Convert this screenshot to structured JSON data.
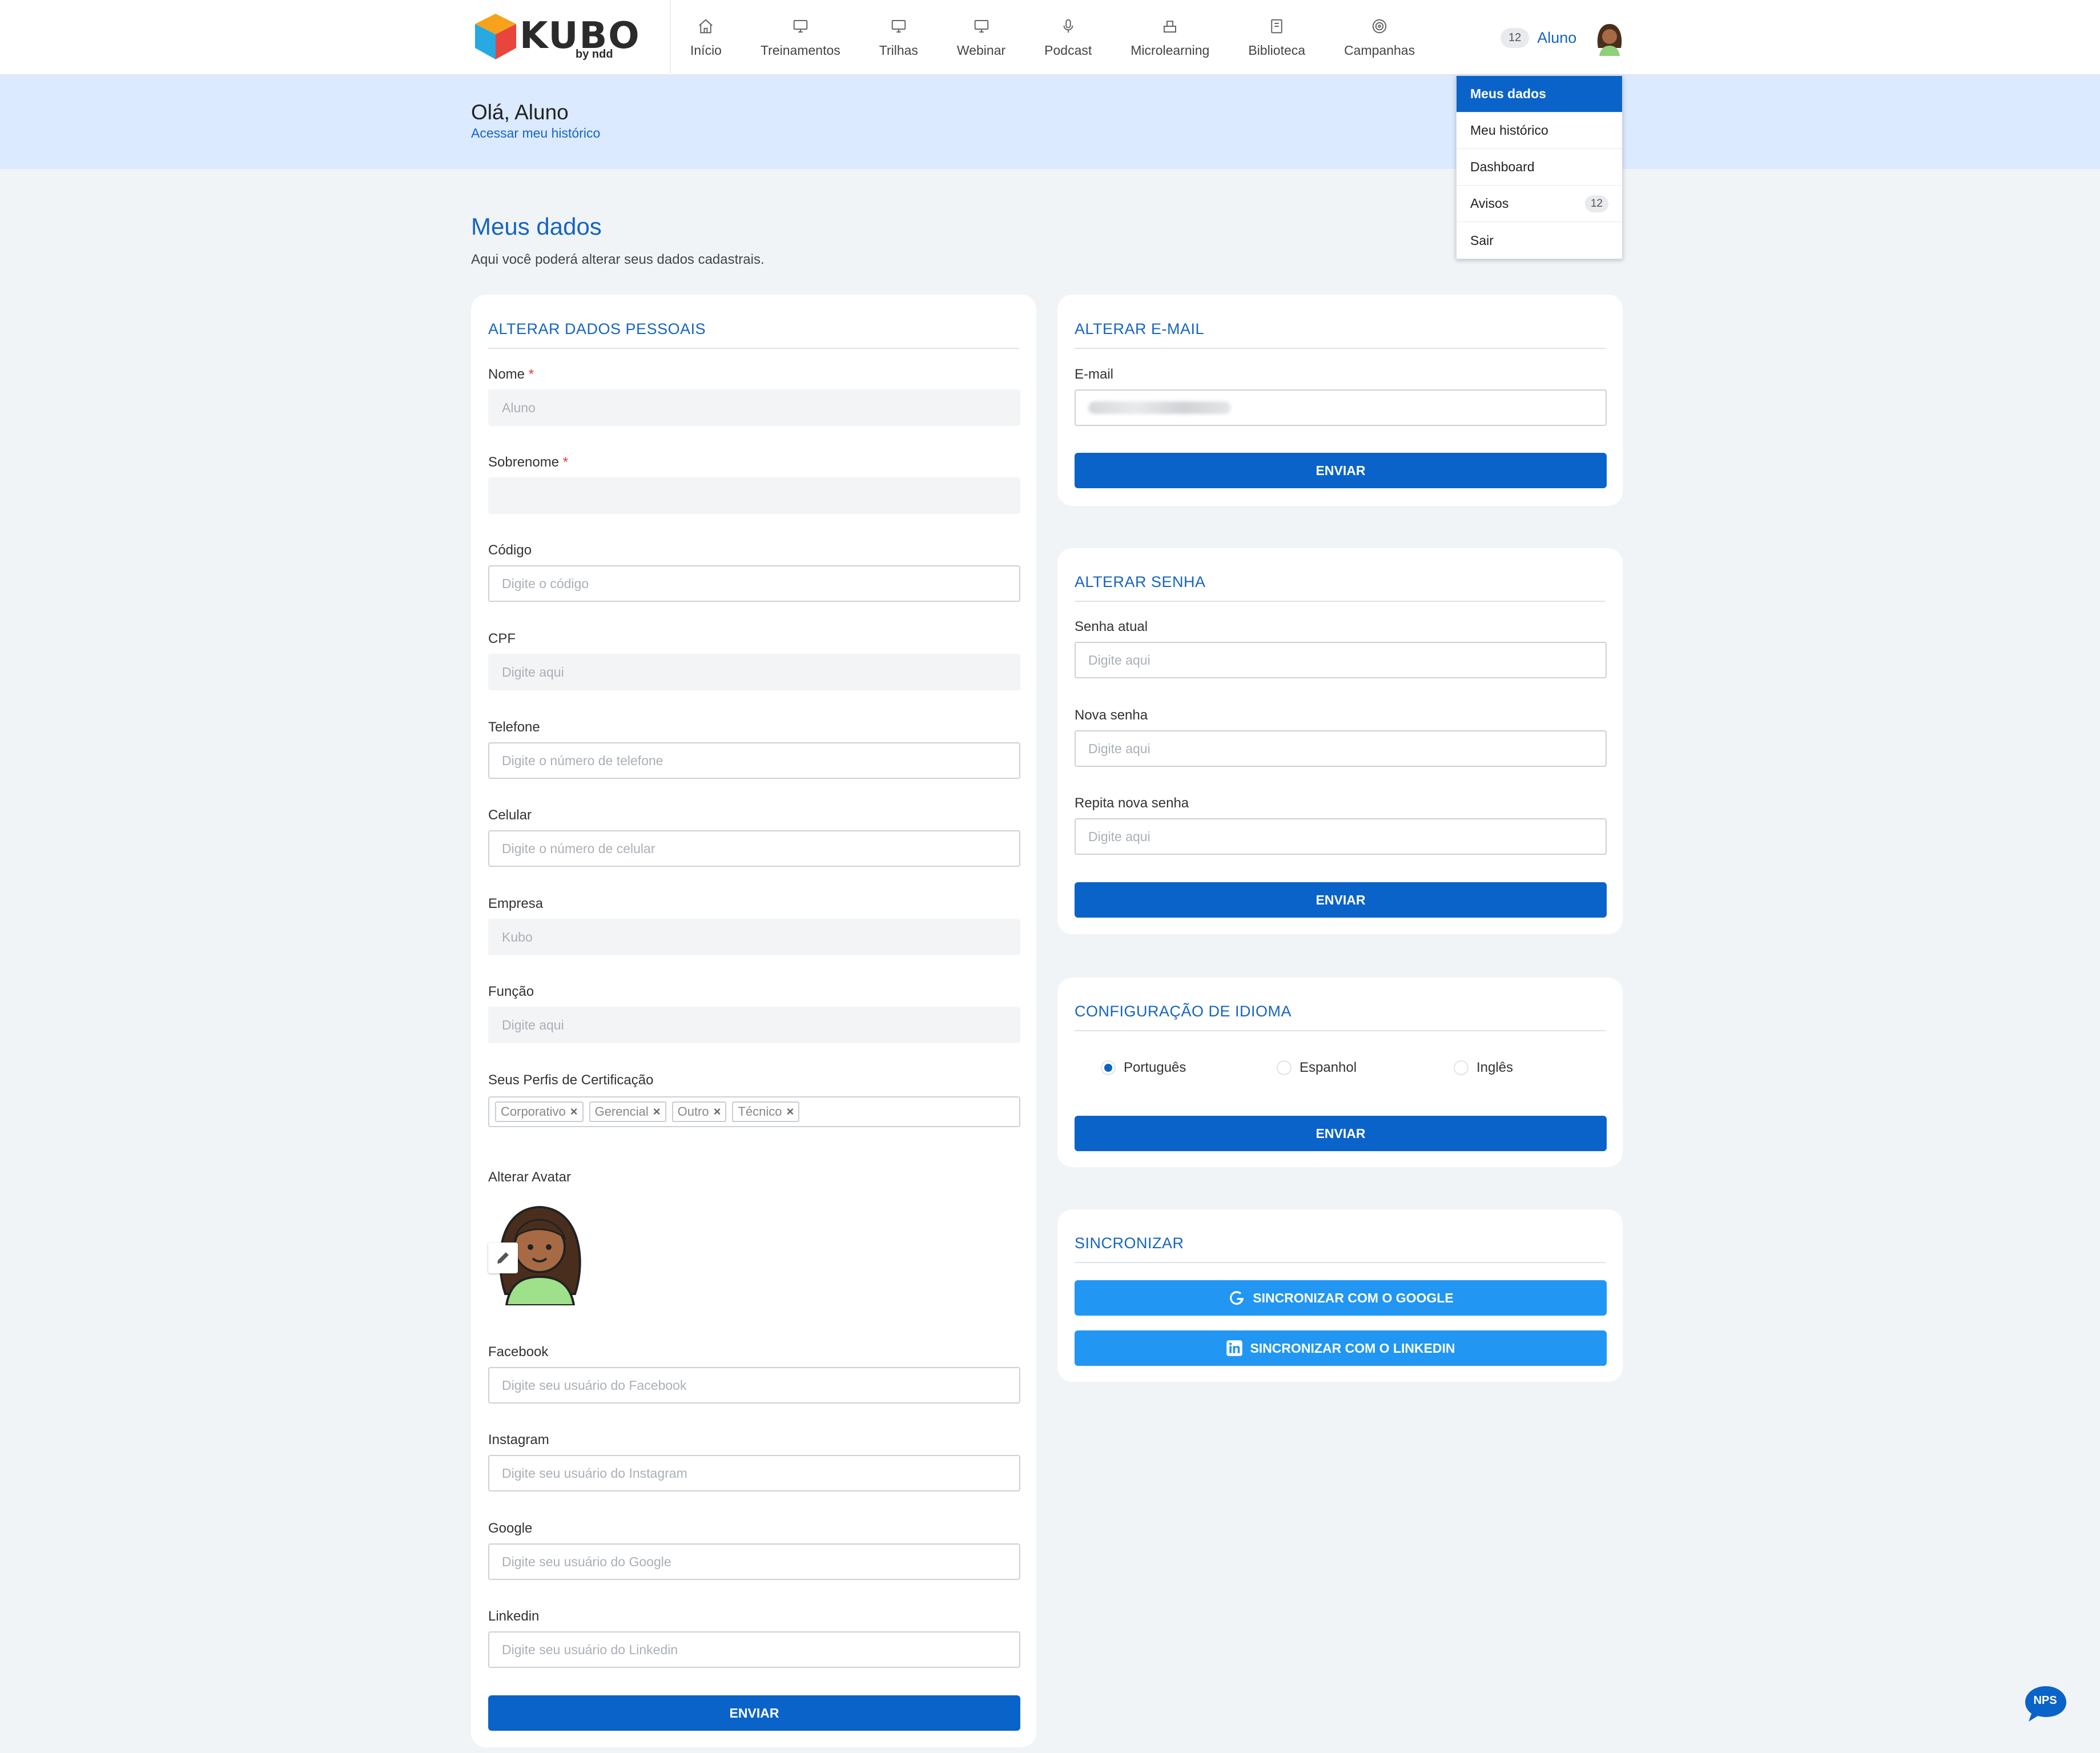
{
  "brand": {
    "logo_text": "KUBO",
    "logo_sub": "by ndd",
    "accent": "#0a63c9"
  },
  "nav": [
    {
      "label": "Início",
      "icon": "home-icon"
    },
    {
      "label": "Treinamentos",
      "icon": "monitor-icon"
    },
    {
      "label": "Trilhas",
      "icon": "monitor-icon"
    },
    {
      "label": "Webinar",
      "icon": "monitor-icon"
    },
    {
      "label": "Podcast",
      "icon": "microphone-icon"
    },
    {
      "label": "Microlearning",
      "icon": "blocks-icon"
    },
    {
      "label": "Biblioteca",
      "icon": "book-icon"
    },
    {
      "label": "Campanhas",
      "icon": "target-icon"
    }
  ],
  "user": {
    "notifications": "12",
    "name": "Aluno"
  },
  "dropdown": {
    "items": [
      {
        "label": "Meus dados"
      },
      {
        "label": "Meu histórico"
      },
      {
        "label": "Dashboard"
      },
      {
        "label": "Avisos",
        "badge": "12"
      },
      {
        "label": "Sair"
      }
    ]
  },
  "banner": {
    "greeting": "Olá, Aluno",
    "history_link": "Acessar meu histórico"
  },
  "page": {
    "title": "Meus dados",
    "subtitle": "Aqui você poderá alterar seus dados cadastrais."
  },
  "personal": {
    "title": "ALTERAR DADOS PESSOAIS",
    "nome_label": "Nome",
    "nome_value": "Aluno",
    "sobrenome_label": "Sobrenome",
    "sobrenome_value": "",
    "codigo_label": "Código",
    "codigo_placeholder": "Digite o código",
    "cpf_label": "CPF",
    "cpf_placeholder": "Digite aqui",
    "telefone_label": "Telefone",
    "telefone_placeholder": "Digite o número de telefone",
    "celular_label": "Celular",
    "celular_placeholder": "Digite o número de celular",
    "empresa_label": "Empresa",
    "empresa_value": "Kubo",
    "funcao_label": "Função",
    "funcao_placeholder": "Digite aqui",
    "perfis_label": "Seus Perfis de Certificação",
    "perfis": [
      "Corporativo",
      "Gerencial",
      "Outro",
      "Técnico"
    ],
    "avatar_label": "Alterar Avatar",
    "facebook_label": "Facebook",
    "facebook_placeholder": "Digite seu usuário do Facebook",
    "instagram_label": "Instagram",
    "instagram_placeholder": "Digite seu usuário do Instagram",
    "google_label": "Google",
    "google_placeholder": "Digite seu usuário do Google",
    "linkedin_label": "Linkedin",
    "linkedin_placeholder": "Digite seu usuário do Linkedin",
    "submit": "ENVIAR"
  },
  "email": {
    "title": "ALTERAR E-MAIL",
    "label": "E-mail",
    "submit": "ENVIAR"
  },
  "password": {
    "title": "ALTERAR SENHA",
    "current_label": "Senha atual",
    "current_placeholder": "Digite aqui",
    "new_label": "Nova senha",
    "new_placeholder": "Digite aqui",
    "repeat_label": "Repita nova senha",
    "repeat_placeholder": "Digite aqui",
    "submit": "ENVIAR"
  },
  "language": {
    "title": "CONFIGURAÇÃO DE IDIOMA",
    "options": [
      "Português",
      "Espanhol",
      "Inglês"
    ],
    "selected": "Português",
    "submit": "ENVIAR"
  },
  "sync": {
    "title": "SINCRONIZAR",
    "google": "SINCRONIZAR COM O GOOGLE",
    "linkedin": "SINCRONIZAR COM O LINKEDIN"
  },
  "nps": {
    "label": "NPS"
  }
}
